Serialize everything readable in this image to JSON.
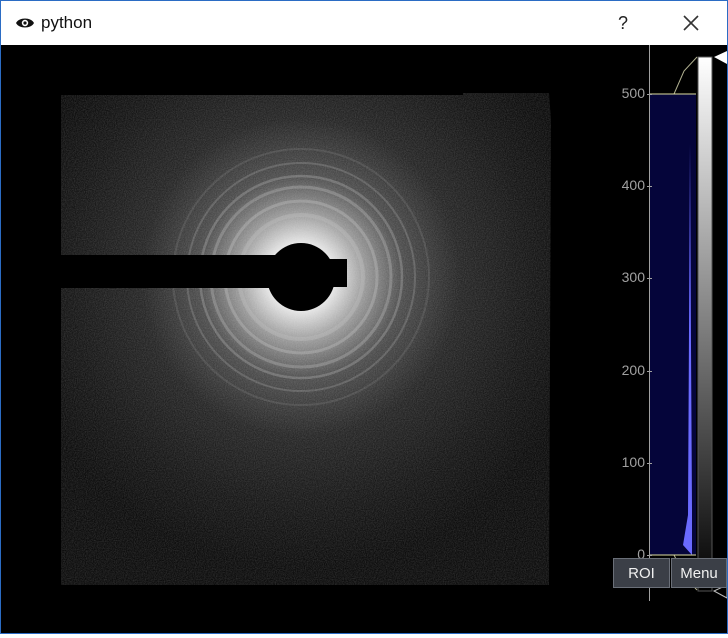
{
  "window": {
    "title": "python",
    "help_label": "?",
    "close_icon": "close-icon",
    "title_icon": "eye-icon"
  },
  "histogram": {
    "axis_ticks": [
      "500",
      "400",
      "300",
      "200",
      "100",
      "0"
    ],
    "tick_values": [
      500,
      400,
      300,
      200,
      100,
      0
    ],
    "level_min": 0,
    "level_max": 500,
    "fill_color": "#05053a",
    "curve_color": "#6a6aff",
    "axis_color": "#a0a0a0",
    "level_line_color": "#ffff64",
    "gradient_colors": [
      "#000000",
      "#ffffff"
    ]
  },
  "buttons": {
    "roi": "ROI",
    "menu": "Menu"
  }
}
